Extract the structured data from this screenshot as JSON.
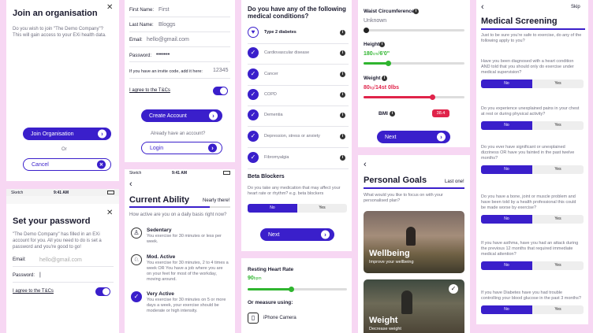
{
  "join": {
    "title": "Join an organisation",
    "body": "Do you wish to join \"The Demo Company\"? This will gain access to your EXi health data.",
    "join_btn": "Join Organisation",
    "or": "Or",
    "cancel_btn": "Cancel"
  },
  "password": {
    "status_left": "Sketch",
    "status_time": "9:41 AM",
    "title": "Set your password",
    "body": "\"The Demo Company\" has filled in an EXi account for you. All you need to do is set a password and you're good to go!",
    "email_label": "Email:",
    "email_placeholder": "hello@gmail.com",
    "password_label": "Password:",
    "password_value": "|",
    "terms": "I agree to the T&Cs"
  },
  "signup": {
    "first_label": "First Name:",
    "first_value": "First",
    "last_label": "Last Name:",
    "last_value": "Bloggs",
    "email_label": "Email:",
    "email_value": "hello@gmail.com",
    "password_label": "Password:",
    "password_value": "•••••••",
    "invite_label": "If you have an invite code, add it here:",
    "invite_value": "12345",
    "terms": "I agree to the T&Cs",
    "create_btn": "Create Account",
    "have_account": "Already have an account?",
    "login_btn": "Login"
  },
  "ability": {
    "status_left": "Sketch",
    "status_time": "9:41 AM",
    "title": "Current Ability",
    "progress_text": "Nearly there!",
    "question": "How active are you on a daily basis right now?",
    "options": [
      {
        "title": "Sedentary",
        "desc": "You exercise for 30 minutes or less per week."
      },
      {
        "title": "Mod. Active",
        "desc": "You exercise for 30 minutes, 2 to 4 times a week OR You have a job where you are on your feet for most of the workday, moving around."
      },
      {
        "title": "Very Active",
        "desc": "You exercise for 30 minutes on 5 or more days a week, your exercise should be moderate or high intensity."
      }
    ]
  },
  "conditions": {
    "title": "Do you have any of the following medical conditions?",
    "items": [
      "Type 2 diabetes",
      "Cardiovascular disease",
      "Cancer",
      "COPD",
      "Dementia",
      "Depression, stress or anxiety",
      "Fibromyalgia"
    ],
    "beta_title": "Beta Blockers",
    "beta_question": "Do you take any medication that may affect your heart rate or rhythm? e.g. beta blockers",
    "no": "No",
    "yes": "Yes",
    "next_btn": "Next"
  },
  "heartrate": {
    "title": "Resting Heart Rate",
    "value": "90",
    "unit": "bpm",
    "or_measure": "Or measure using:",
    "camera": "iPhone Camera"
  },
  "measures": {
    "waist_label": "Waist Circumference",
    "waist_value": "Unknown",
    "height_label": "Height",
    "height_value": "180",
    "height_unit": "cm",
    "height_sep": "/",
    "height_alt": "6'0\"",
    "weight_label": "Weight",
    "weight_value": "80",
    "weight_unit": "kg",
    "weight_alt": "14st 0lbs",
    "bmi_label": "BMI",
    "bmi_value": "38.4",
    "next_btn": "Next"
  },
  "goals": {
    "title": "Personal Goals",
    "progress_text": "Last one!",
    "question": "What would you like to focus on with your personalised plan?",
    "cards": [
      {
        "title": "Wellbeing",
        "sub": "Improve your wellbeing"
      },
      {
        "title": "Weight",
        "sub": "Decrease weight"
      }
    ]
  },
  "screening": {
    "skip": "Skip",
    "title": "Medical Screening",
    "intro": "Just to be sure you're safe to exercise, do any of the following apply to you?",
    "no": "No",
    "yes": "Yes",
    "questions": [
      "Have you been diagnosed with a heart condition AND told that you should only do exercise under medical supervision?",
      "Do you experience unexplained pains in your chest at rest or during physical activity?",
      "Do you ever have significant or unexplained dizziness OR have you fainted in the past twelve months?",
      "Do you have a bone, joint or muscle problem and have been told by a health professional this could be made worse by exercise?",
      "If you have asthma, have you had an attack during the previous 12 months that required immediate medical attention?",
      "If you have Diabetes have you had trouble controlling your blood glucose in the past 3 months?"
    ]
  },
  "colors": {
    "accent": "#3a1fcb",
    "background": "#f7d7f3",
    "height": "#2fb52f",
    "weight": "#e0234a"
  }
}
